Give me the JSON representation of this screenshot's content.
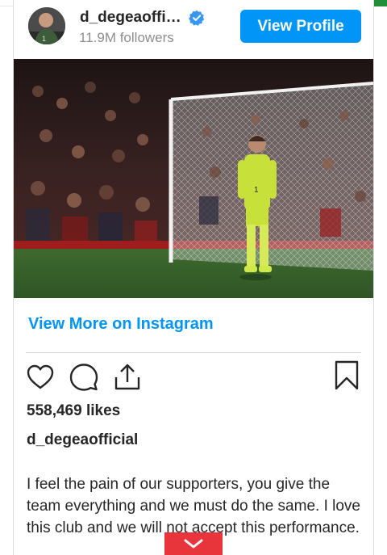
{
  "header": {
    "username": "d_degeaofficial",
    "verified": true,
    "followers": "11.9M followers",
    "view_profile_label": "View Profile"
  },
  "post": {
    "image_subject": "goalkeeper in yellow kit standing in front of goal with stadium crowd",
    "view_more_label": "View More on Instagram",
    "likes": "558,469 likes",
    "caption_username": "d_degeaofficial",
    "caption_text": "I feel the pain of our supporters, you give the team everything and we must do the same. I love this club and we will not accept this performance."
  },
  "icons": {
    "like": "heart-icon",
    "comment": "comment-icon",
    "share": "share-icon",
    "save": "bookmark-icon",
    "verified": "verified-badge-icon",
    "expand": "chevron-down-icon"
  },
  "colors": {
    "accent": "#0095f6",
    "text": "#262626",
    "muted": "#8e8e8e",
    "border": "#dbdbdb",
    "expand_tab": "#e8353c"
  }
}
